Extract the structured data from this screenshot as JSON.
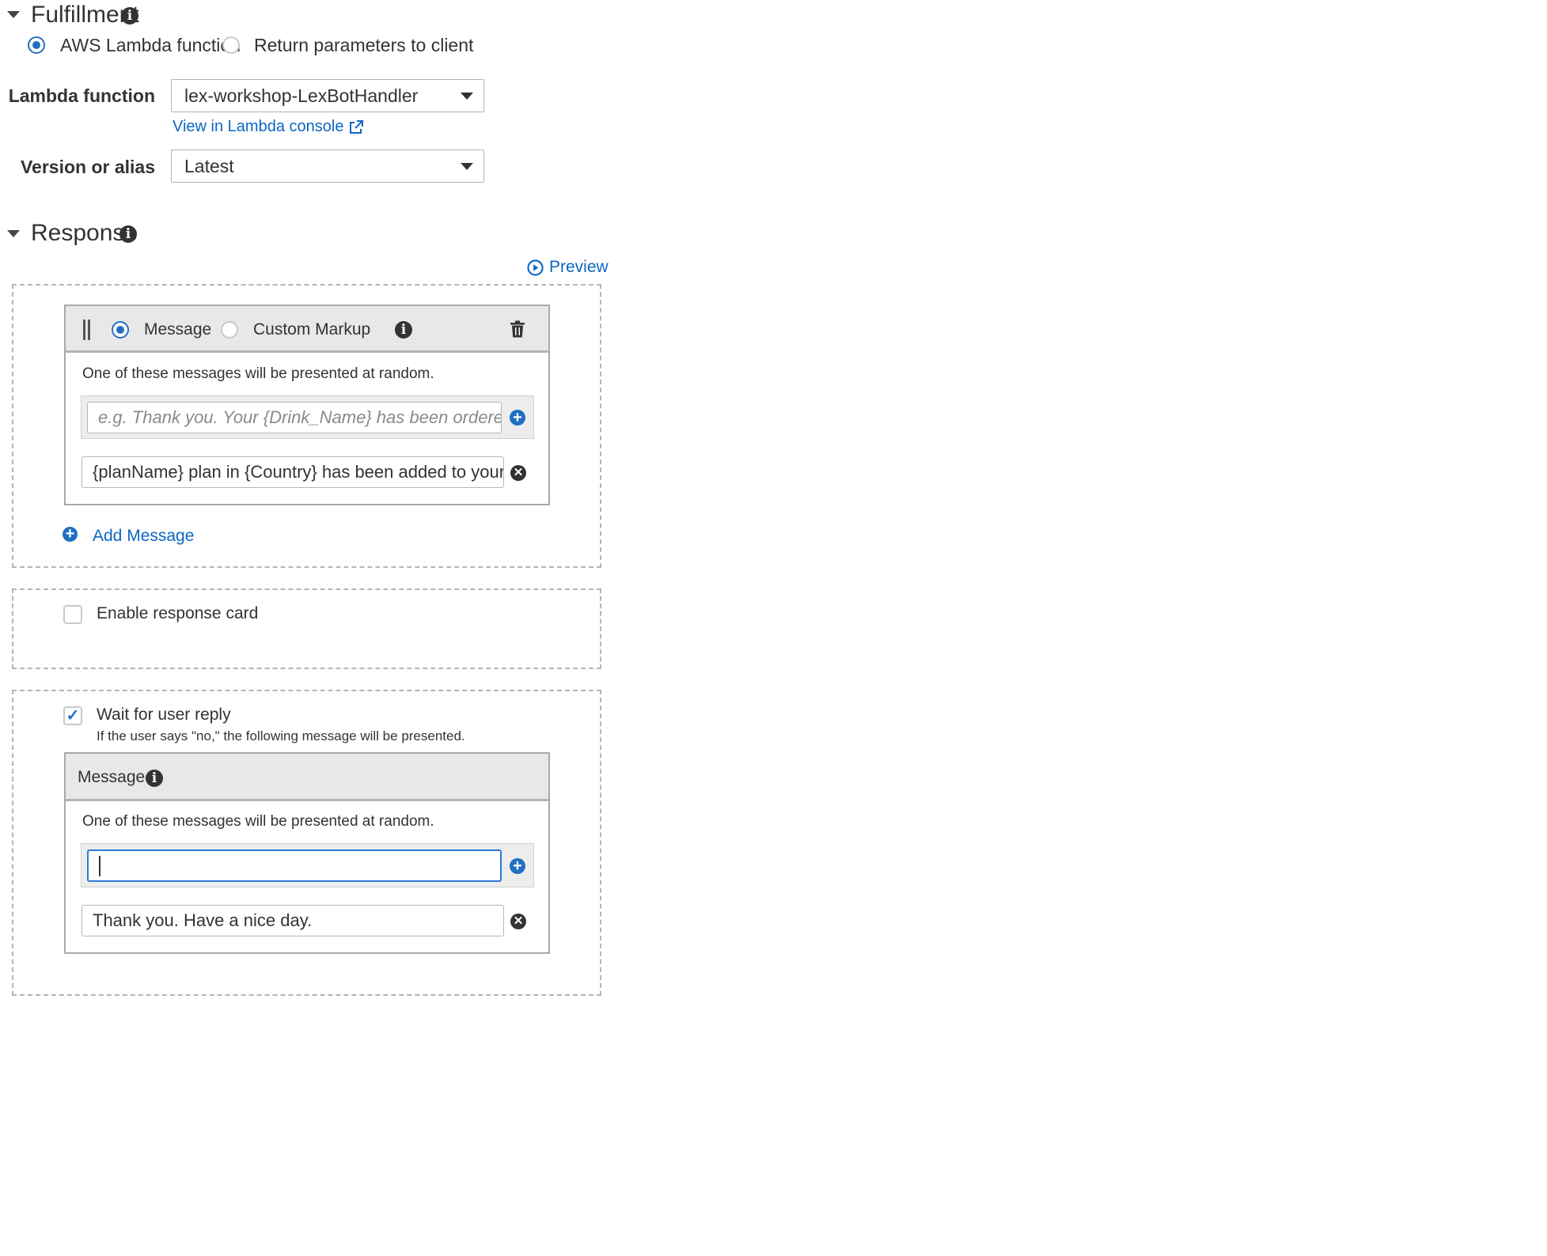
{
  "fulfillment": {
    "title": "Fulfillment",
    "options": [
      "AWS Lambda function",
      "Return parameters to client"
    ],
    "selected": "AWS Lambda function",
    "lambda_label": "Lambda function",
    "lambda_value": "lex-workshop-LexBotHandler",
    "console_link": "View in Lambda console",
    "version_label": "Version or alias",
    "version_value": "Latest"
  },
  "response": {
    "title": "Response",
    "preview_label": "Preview",
    "message_type_options": [
      "Message",
      "Custom Markup"
    ],
    "message_type_selected": "Message",
    "random_note": "One of these messages will be presented at random.",
    "input_placeholder": "e.g. Thank you. Your {Drink_Name} has been ordered.",
    "messages": [
      "{planName} plan in {Country} has been added to your account. W"
    ],
    "add_message_label": "Add Message",
    "response_card_label": "Enable response card",
    "response_card_checked": false,
    "wait_label": "Wait for user reply",
    "wait_checked": true,
    "wait_note": "If the user says \"no,\" the following message will be presented.",
    "wait_card_title": "Message",
    "wait_random_note": "One of these messages will be presented at random.",
    "wait_input_value": "",
    "wait_messages": [
      "Thank you. Have a nice day."
    ]
  },
  "colors": {
    "accent": "#1f6fc1",
    "link": "#0d66c2",
    "header_bg": "#e8e8e8"
  }
}
